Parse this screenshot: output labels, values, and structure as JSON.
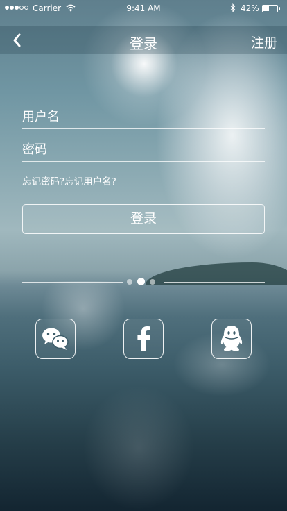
{
  "status_bar": {
    "carrier": "Carrier",
    "time": "9:41 AM",
    "battery_percent": "42%",
    "battery_level": 0.42,
    "signal_bars_filled": 3,
    "signal_bars_total": 5
  },
  "nav": {
    "title": "登录",
    "register": "注册",
    "back_icon": "chevron-left-icon"
  },
  "form": {
    "username_placeholder": "用户名",
    "username_value": "",
    "password_placeholder": "密码",
    "password_value": "",
    "forgot_password": "忘记密码?",
    "forgot_username": "忘记用户名?",
    "login_button": "登录"
  },
  "pager": {
    "count": 3,
    "active_index": 1
  },
  "social": [
    {
      "icon": "wechat-icon"
    },
    {
      "icon": "facebook-icon"
    },
    {
      "icon": "qq-icon"
    }
  ],
  "colors": {
    "text": "#ffffff",
    "sky_top": "#5f7f8d",
    "sea_bottom": "#132531"
  }
}
